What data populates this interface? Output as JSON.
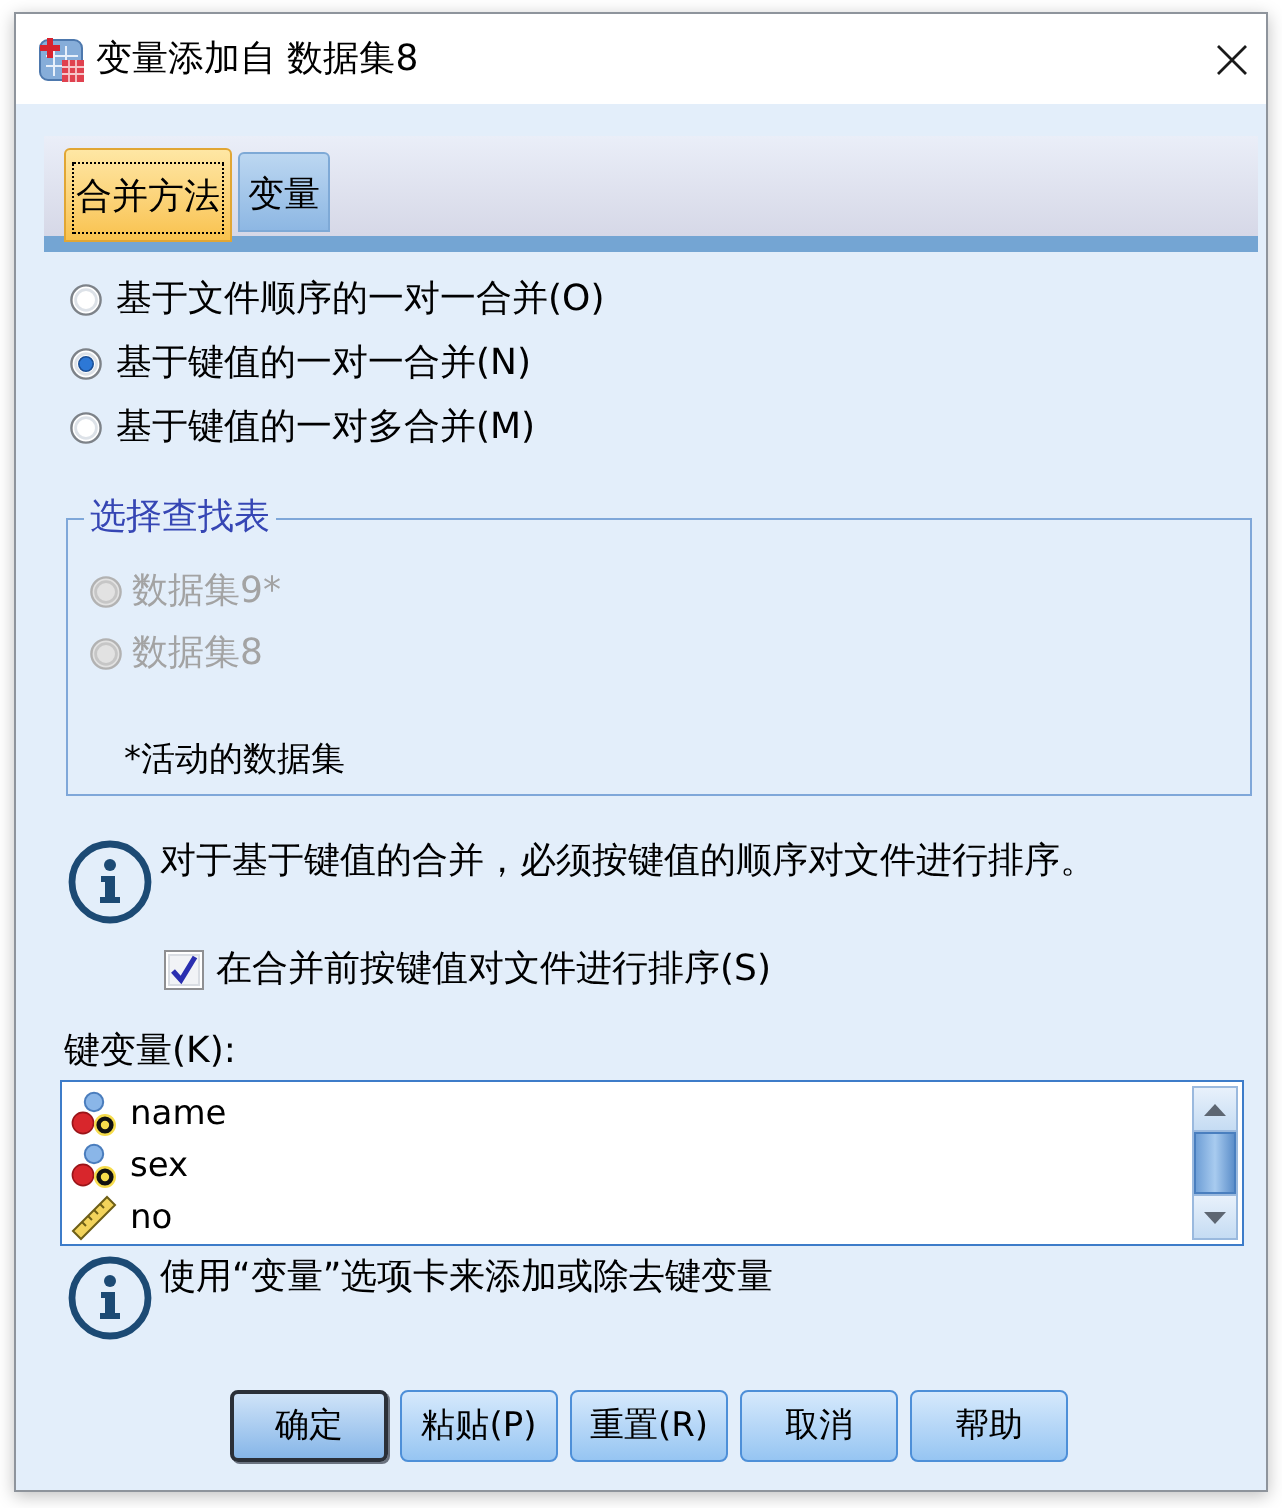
{
  "window": {
    "title": "变量添加自 数据集8"
  },
  "tabs": [
    {
      "label": "合并方法",
      "selected": true
    },
    {
      "label": "变量",
      "selected": false
    }
  ],
  "merge_methods": [
    {
      "label": "基于文件顺序的一对一合并(O)",
      "selected": false
    },
    {
      "label": "基于键值的一对一合并(N)",
      "selected": true
    },
    {
      "label": "基于键值的一对多合并(M)",
      "selected": false
    }
  ],
  "lookup_table": {
    "title": "选择查找表",
    "options": [
      {
        "label": "数据集9*",
        "selected": false,
        "disabled": true
      },
      {
        "label": "数据集8",
        "selected": false,
        "disabled": true
      }
    ],
    "note": "*活动的数据集"
  },
  "sort_info": "对于基于键值的合并，必须按键值的顺序对文件进行排序。",
  "sort_checkbox": {
    "label": "在合并前按键值对文件进行排序(S)",
    "checked": true
  },
  "key_variables": {
    "label": "键变量(K):",
    "items": [
      {
        "name": "name",
        "kind": "string"
      },
      {
        "name": "sex",
        "kind": "string"
      },
      {
        "name": "no",
        "kind": "scale"
      }
    ]
  },
  "key_info": "使用“变量”选项卡来添加或除去键变量",
  "buttons": [
    {
      "label": "确定",
      "default": true
    },
    {
      "label": "粘贴(P)",
      "default": false
    },
    {
      "label": "重置(R)",
      "default": false
    },
    {
      "label": "取消",
      "default": false
    },
    {
      "label": "帮助",
      "default": false
    }
  ]
}
